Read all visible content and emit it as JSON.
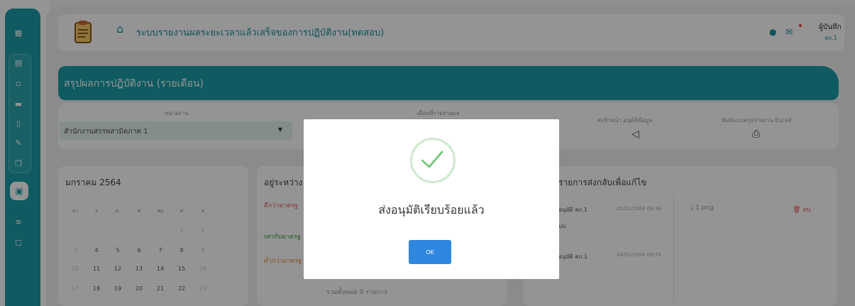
{
  "app": {
    "title": "ระบบรายงานผลระยะเวลาแล้วเสร็จของการปฏิบัติงาน(ทดสอบ)"
  },
  "user": {
    "name": "ผู้บันทึก",
    "org": "สภ.1"
  },
  "banner": {
    "title": "สรุปผลการปฏิบัติงาน (รายเดือน)"
  },
  "filters": {
    "unit_label": "หน่วยงาน",
    "unit_value": "สำนักงานสรรพสามิตภาค 1",
    "month_label": "เดือนที่รายงานผล",
    "send_label": "ส่งหัวหน้า อนุมัติข้อมูล",
    "print_label": "พิมพ์แบบสรุปรายงาน Excell"
  },
  "calendar": {
    "title": "มกราคม 2564",
    "dow": [
      "อา",
      "จ",
      "อ.",
      "พ",
      "พฤ",
      "ศ",
      "ส"
    ],
    "rows": [
      [
        "",
        "",
        "",
        "",
        "",
        "1",
        "2"
      ],
      [
        "3",
        "4",
        "5",
        "6",
        "7",
        "8",
        "9"
      ],
      [
        "10",
        "11",
        "12",
        "13",
        "14",
        "15",
        "16"
      ],
      [
        "17",
        "18",
        "19",
        "20",
        "21",
        "22",
        "23"
      ]
    ]
  },
  "mid": {
    "title": "อยู่ระหว่าง",
    "item1": "ดีกว่ามาตรฐ",
    "item2": "เท่ากับมาตรฐ",
    "item3": "ต่ำกว่ามาตรฐ",
    "total": "รวมทั้งหมด 0 รายการ"
  },
  "right": {
    "title": "รายการส่งกลับเพื่อแก้ไข",
    "rows": [
      {
        "actor": "อนุมัติ สภ.1",
        "sub": "บบ",
        "date": "05/01/2564 09:38"
      },
      {
        "actor": "อนุมัติ สภ.1",
        "date": "04/01/2564 09:35"
      }
    ],
    "file": "1.png",
    "delete": "ลบ"
  },
  "modal": {
    "message": "ส่งอนุมัติเรียบร้อยแล้ว",
    "ok": "OK"
  },
  "colors": {
    "primary": "#1a9ea8",
    "ok": "#2e86de",
    "success": "#4caf50"
  }
}
